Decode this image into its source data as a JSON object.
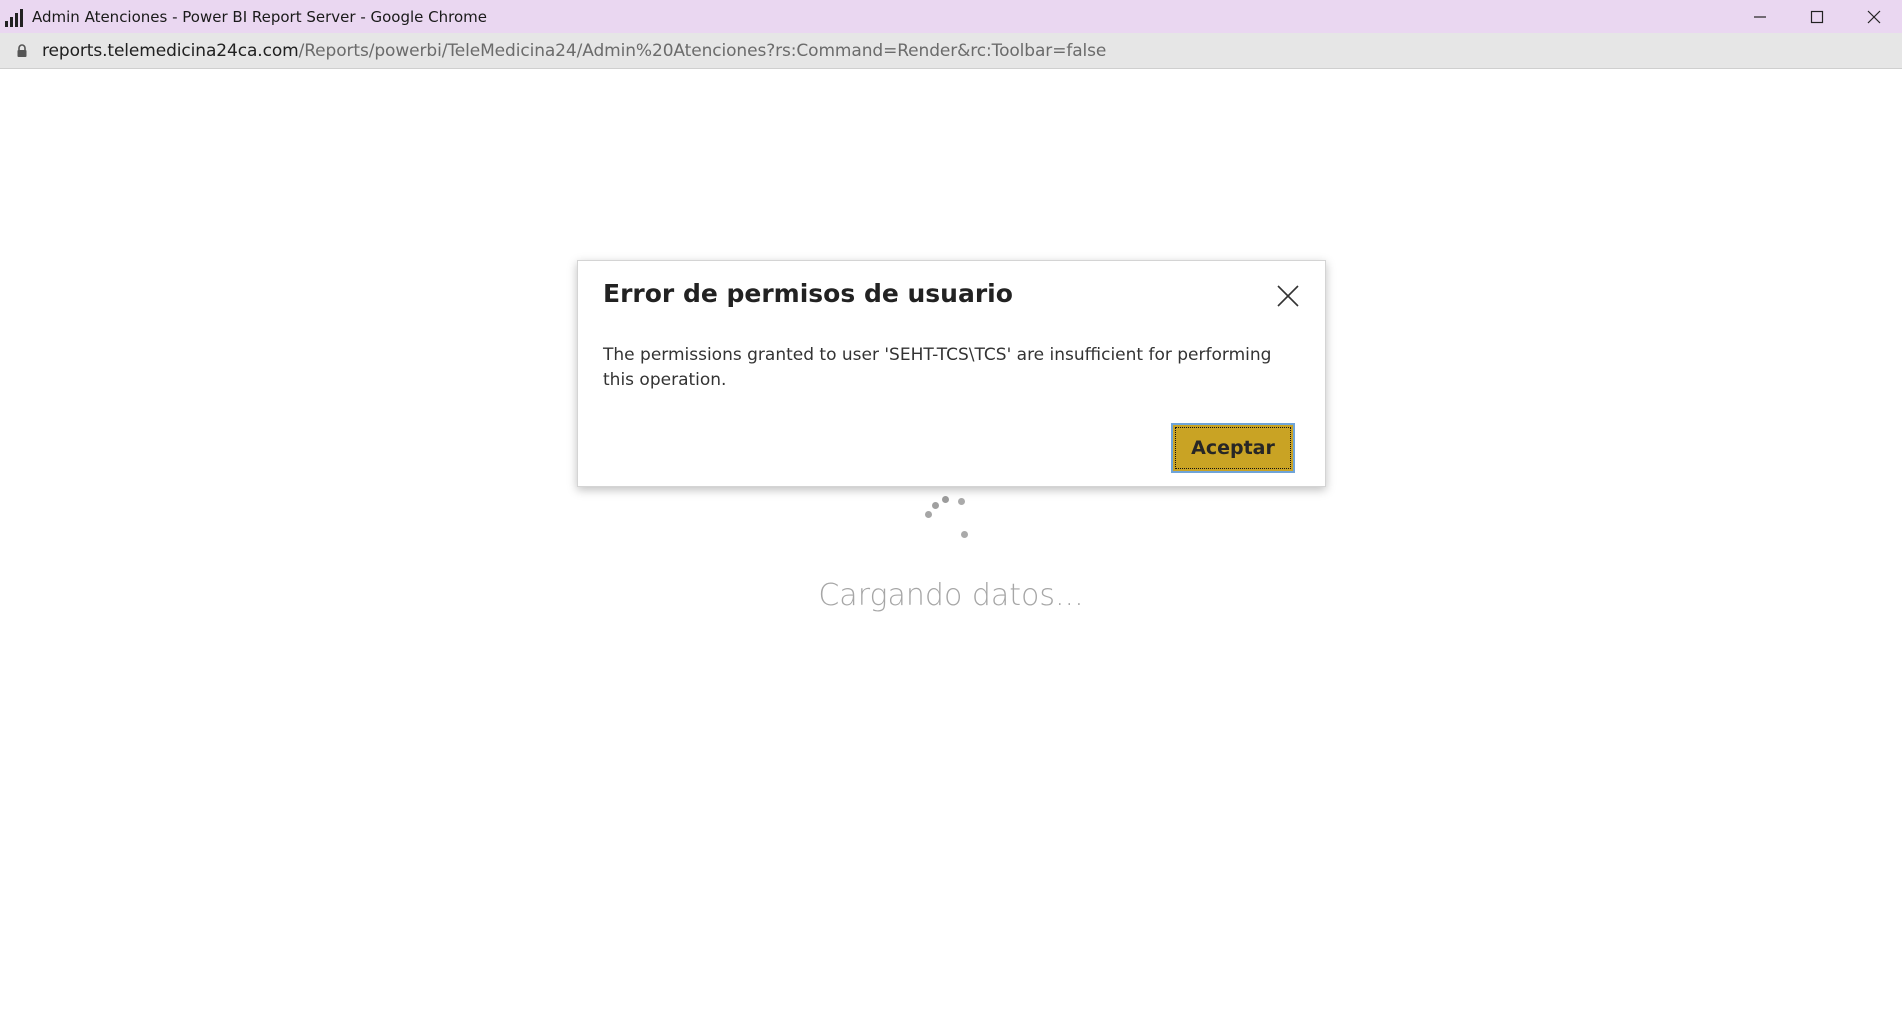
{
  "window": {
    "title": "Admin Atenciones - Power BI Report Server - Google Chrome",
    "app_icon": "bar-chart-icon",
    "controls": [
      "minimize-icon",
      "maximize-icon",
      "close-icon"
    ]
  },
  "address_bar": {
    "lock_icon": "lock-icon",
    "url_host": "reports.telemedicina24ca.com",
    "url_path": "/Reports/powerbi/TeleMedicina24/Admin%20Atenciones?rs:Command=Render&rc:Toolbar=false"
  },
  "page": {
    "loading_text": "Cargando datos..."
  },
  "dialog": {
    "title": "Error de permisos de usuario",
    "message": "The permissions granted to user 'SEHT-TCS\\TCS' are insufficient for performing this operation.",
    "accept_label": "Aceptar",
    "close_icon": "close-icon",
    "accent_color": "#c9a324"
  }
}
